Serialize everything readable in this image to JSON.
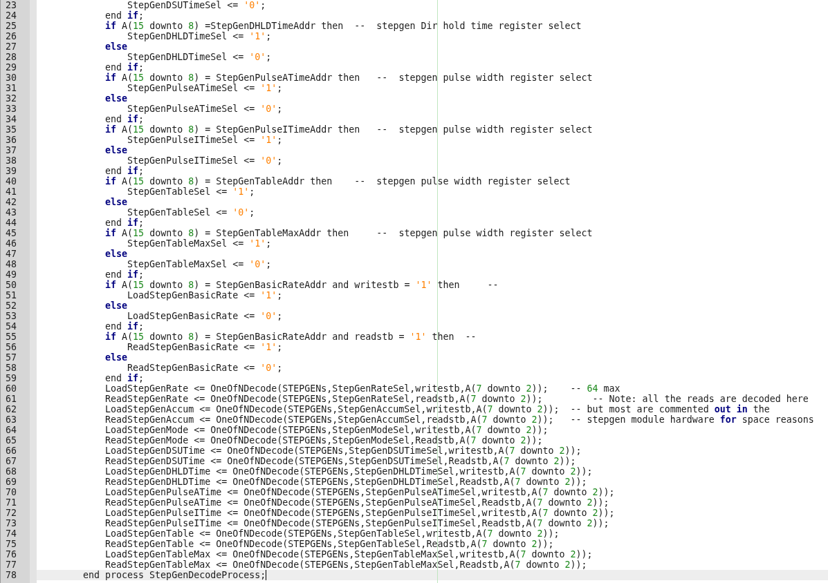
{
  "editor": {
    "lines": [
      {
        "number": "23",
        "current": false,
        "segments": [
          {
            "kind": "plain",
            "text": "                StepGenDSUTimeSel <= "
          },
          {
            "kind": "string",
            "text": "'0'"
          },
          {
            "kind": "plain",
            "text": ";"
          }
        ]
      },
      {
        "number": "24",
        "current": false,
        "segments": [
          {
            "kind": "plain",
            "text": "            end "
          },
          {
            "kind": "keyword",
            "text": "if"
          },
          {
            "kind": "plain",
            "text": ";"
          }
        ]
      },
      {
        "number": "25",
        "current": false,
        "segments": [
          {
            "kind": "keyword",
            "text": "            if"
          },
          {
            "kind": "plain",
            "text": " A("
          },
          {
            "kind": "number",
            "text": "15"
          },
          {
            "kind": "plain",
            "text": " downto "
          },
          {
            "kind": "number",
            "text": "8"
          },
          {
            "kind": "plain",
            "text": ") =StepGenDHLDTimeAddr then  --  stepgen Dir hold time register select"
          }
        ]
      },
      {
        "number": "26",
        "current": false,
        "segments": [
          {
            "kind": "plain",
            "text": "                StepGenDHLDTimeSel <= "
          },
          {
            "kind": "string",
            "text": "'1'"
          },
          {
            "kind": "plain",
            "text": ";"
          }
        ]
      },
      {
        "number": "27",
        "current": false,
        "segments": [
          {
            "kind": "keyword",
            "text": "            else"
          }
        ]
      },
      {
        "number": "28",
        "current": false,
        "segments": [
          {
            "kind": "plain",
            "text": "                StepGenDHLDTimeSel <= "
          },
          {
            "kind": "string",
            "text": "'0'"
          },
          {
            "kind": "plain",
            "text": ";"
          }
        ]
      },
      {
        "number": "29",
        "current": false,
        "segments": [
          {
            "kind": "plain",
            "text": "            end "
          },
          {
            "kind": "keyword",
            "text": "if"
          },
          {
            "kind": "plain",
            "text": ";"
          }
        ]
      },
      {
        "number": "30",
        "current": false,
        "segments": [
          {
            "kind": "keyword",
            "text": "            if"
          },
          {
            "kind": "plain",
            "text": " A("
          },
          {
            "kind": "number",
            "text": "15"
          },
          {
            "kind": "plain",
            "text": " downto "
          },
          {
            "kind": "number",
            "text": "8"
          },
          {
            "kind": "plain",
            "text": ") = StepGenPulseATimeAddr then   --  stepgen pulse width register select"
          }
        ]
      },
      {
        "number": "31",
        "current": false,
        "segments": [
          {
            "kind": "plain",
            "text": "                StepGenPulseATimeSel <= "
          },
          {
            "kind": "string",
            "text": "'1'"
          },
          {
            "kind": "plain",
            "text": ";"
          }
        ]
      },
      {
        "number": "32",
        "current": false,
        "segments": [
          {
            "kind": "keyword",
            "text": "            else"
          }
        ]
      },
      {
        "number": "33",
        "current": false,
        "segments": [
          {
            "kind": "plain",
            "text": "                StepGenPulseATimeSel <= "
          },
          {
            "kind": "string",
            "text": "'0'"
          },
          {
            "kind": "plain",
            "text": ";"
          }
        ]
      },
      {
        "number": "34",
        "current": false,
        "segments": [
          {
            "kind": "plain",
            "text": "            end "
          },
          {
            "kind": "keyword",
            "text": "if"
          },
          {
            "kind": "plain",
            "text": ";"
          }
        ]
      },
      {
        "number": "35",
        "current": false,
        "segments": [
          {
            "kind": "keyword",
            "text": "            if"
          },
          {
            "kind": "plain",
            "text": " A("
          },
          {
            "kind": "number",
            "text": "15"
          },
          {
            "kind": "plain",
            "text": " downto "
          },
          {
            "kind": "number",
            "text": "8"
          },
          {
            "kind": "plain",
            "text": ") = StepGenPulseITimeAddr then   --  stepgen pulse width register select"
          }
        ]
      },
      {
        "number": "36",
        "current": false,
        "segments": [
          {
            "kind": "plain",
            "text": "                StepGenPulseITimeSel <= "
          },
          {
            "kind": "string",
            "text": "'1'"
          },
          {
            "kind": "plain",
            "text": ";"
          }
        ]
      },
      {
        "number": "37",
        "current": false,
        "segments": [
          {
            "kind": "keyword",
            "text": "            else"
          }
        ]
      },
      {
        "number": "38",
        "current": false,
        "segments": [
          {
            "kind": "plain",
            "text": "                StepGenPulseITimeSel <= "
          },
          {
            "kind": "string",
            "text": "'0'"
          },
          {
            "kind": "plain",
            "text": ";"
          }
        ]
      },
      {
        "number": "39",
        "current": false,
        "segments": [
          {
            "kind": "plain",
            "text": "            end "
          },
          {
            "kind": "keyword",
            "text": "if"
          },
          {
            "kind": "plain",
            "text": ";"
          }
        ]
      },
      {
        "number": "40",
        "current": false,
        "segments": [
          {
            "kind": "keyword",
            "text": "            if"
          },
          {
            "kind": "plain",
            "text": " A("
          },
          {
            "kind": "number",
            "text": "15"
          },
          {
            "kind": "plain",
            "text": " downto "
          },
          {
            "kind": "number",
            "text": "8"
          },
          {
            "kind": "plain",
            "text": ") = StepGenTableAddr then    --  stepgen pulse width register select"
          }
        ]
      },
      {
        "number": "41",
        "current": false,
        "segments": [
          {
            "kind": "plain",
            "text": "                StepGenTableSel <= "
          },
          {
            "kind": "string",
            "text": "'1'"
          },
          {
            "kind": "plain",
            "text": ";"
          }
        ]
      },
      {
        "number": "42",
        "current": false,
        "segments": [
          {
            "kind": "keyword",
            "text": "            else"
          }
        ]
      },
      {
        "number": "43",
        "current": false,
        "segments": [
          {
            "kind": "plain",
            "text": "                StepGenTableSel <= "
          },
          {
            "kind": "string",
            "text": "'0'"
          },
          {
            "kind": "plain",
            "text": ";"
          }
        ]
      },
      {
        "number": "44",
        "current": false,
        "segments": [
          {
            "kind": "plain",
            "text": "            end "
          },
          {
            "kind": "keyword",
            "text": "if"
          },
          {
            "kind": "plain",
            "text": ";"
          }
        ]
      },
      {
        "number": "45",
        "current": false,
        "segments": [
          {
            "kind": "keyword",
            "text": "            if"
          },
          {
            "kind": "plain",
            "text": " A("
          },
          {
            "kind": "number",
            "text": "15"
          },
          {
            "kind": "plain",
            "text": " downto "
          },
          {
            "kind": "number",
            "text": "8"
          },
          {
            "kind": "plain",
            "text": ") = StepGenTableMaxAddr then     --  stepgen pulse width register select"
          }
        ]
      },
      {
        "number": "46",
        "current": false,
        "segments": [
          {
            "kind": "plain",
            "text": "                StepGenTableMaxSel <= "
          },
          {
            "kind": "string",
            "text": "'1'"
          },
          {
            "kind": "plain",
            "text": ";"
          }
        ]
      },
      {
        "number": "47",
        "current": false,
        "segments": [
          {
            "kind": "keyword",
            "text": "            else"
          }
        ]
      },
      {
        "number": "48",
        "current": false,
        "segments": [
          {
            "kind": "plain",
            "text": "                StepGenTableMaxSel <= "
          },
          {
            "kind": "string",
            "text": "'0'"
          },
          {
            "kind": "plain",
            "text": ";"
          }
        ]
      },
      {
        "number": "49",
        "current": false,
        "segments": [
          {
            "kind": "plain",
            "text": "            end "
          },
          {
            "kind": "keyword",
            "text": "if"
          },
          {
            "kind": "plain",
            "text": ";"
          }
        ]
      },
      {
        "number": "50",
        "current": false,
        "segments": [
          {
            "kind": "keyword",
            "text": "            if"
          },
          {
            "kind": "plain",
            "text": " A("
          },
          {
            "kind": "number",
            "text": "15"
          },
          {
            "kind": "plain",
            "text": " downto "
          },
          {
            "kind": "number",
            "text": "8"
          },
          {
            "kind": "plain",
            "text": ") = StepGenBasicRateAddr and writestb = "
          },
          {
            "kind": "string",
            "text": "'1'"
          },
          {
            "kind": "plain",
            "text": " then     --"
          }
        ]
      },
      {
        "number": "51",
        "current": false,
        "segments": [
          {
            "kind": "plain",
            "text": "                LoadStepGenBasicRate <= "
          },
          {
            "kind": "string",
            "text": "'1'"
          },
          {
            "kind": "plain",
            "text": ";"
          }
        ]
      },
      {
        "number": "52",
        "current": false,
        "segments": [
          {
            "kind": "keyword",
            "text": "            else"
          }
        ]
      },
      {
        "number": "53",
        "current": false,
        "segments": [
          {
            "kind": "plain",
            "text": "                LoadStepGenBasicRate <= "
          },
          {
            "kind": "string",
            "text": "'0'"
          },
          {
            "kind": "plain",
            "text": ";"
          }
        ]
      },
      {
        "number": "54",
        "current": false,
        "segments": [
          {
            "kind": "plain",
            "text": "            end "
          },
          {
            "kind": "keyword",
            "text": "if"
          },
          {
            "kind": "plain",
            "text": ";"
          }
        ]
      },
      {
        "number": "55",
        "current": false,
        "segments": [
          {
            "kind": "keyword",
            "text": "            if"
          },
          {
            "kind": "plain",
            "text": " A("
          },
          {
            "kind": "number",
            "text": "15"
          },
          {
            "kind": "plain",
            "text": " downto "
          },
          {
            "kind": "number",
            "text": "8"
          },
          {
            "kind": "plain",
            "text": ") = StepGenBasicRateAddr and readstb = "
          },
          {
            "kind": "string",
            "text": "'1'"
          },
          {
            "kind": "plain",
            "text": " then  --"
          }
        ]
      },
      {
        "number": "56",
        "current": false,
        "segments": [
          {
            "kind": "plain",
            "text": "                ReadStepGenBasicRate <= "
          },
          {
            "kind": "string",
            "text": "'1'"
          },
          {
            "kind": "plain",
            "text": ";"
          }
        ]
      },
      {
        "number": "57",
        "current": false,
        "segments": [
          {
            "kind": "keyword",
            "text": "            else"
          }
        ]
      },
      {
        "number": "58",
        "current": false,
        "segments": [
          {
            "kind": "plain",
            "text": "                ReadStepGenBasicRate <= "
          },
          {
            "kind": "string",
            "text": "'0'"
          },
          {
            "kind": "plain",
            "text": ";"
          }
        ]
      },
      {
        "number": "59",
        "current": false,
        "segments": [
          {
            "kind": "plain",
            "text": "            end "
          },
          {
            "kind": "keyword",
            "text": "if"
          },
          {
            "kind": "plain",
            "text": ";"
          }
        ]
      },
      {
        "number": "60",
        "current": false,
        "segments": [
          {
            "kind": "plain",
            "text": "            LoadStepGenRate <= OneOfNDecode(STEPGENs,StepGenRateSel,writestb,A("
          },
          {
            "kind": "number",
            "text": "7"
          },
          {
            "kind": "plain",
            "text": " downto "
          },
          {
            "kind": "number",
            "text": "2"
          },
          {
            "kind": "plain",
            "text": "));    -- "
          },
          {
            "kind": "number",
            "text": "64"
          },
          {
            "kind": "plain",
            "text": " max"
          }
        ]
      },
      {
        "number": "61",
        "current": false,
        "segments": [
          {
            "kind": "plain",
            "text": "            ReadStepGenRate <= OneOfNDecode(STEPGENs,StepGenRateSel,readstb,A("
          },
          {
            "kind": "number",
            "text": "7"
          },
          {
            "kind": "plain",
            "text": " downto "
          },
          {
            "kind": "number",
            "text": "2"
          },
          {
            "kind": "plain",
            "text": "));         -- Note: all the reads are decoded here"
          }
        ]
      },
      {
        "number": "62",
        "current": false,
        "segments": [
          {
            "kind": "plain",
            "text": "            LoadStepGenAccum <= OneOfNDecode(STEPGENs,StepGenAccumSel,writestb,A("
          },
          {
            "kind": "number",
            "text": "7"
          },
          {
            "kind": "plain",
            "text": " downto "
          },
          {
            "kind": "number",
            "text": "2"
          },
          {
            "kind": "plain",
            "text": "));  -- but most are commented "
          },
          {
            "kind": "keyword",
            "text": "out in"
          },
          {
            "kind": "plain",
            "text": " the"
          }
        ]
      },
      {
        "number": "63",
        "current": false,
        "segments": [
          {
            "kind": "plain",
            "text": "            ReadStepGenAccum <= OneOfNDecode(STEPGENs,StepGenAccumSel,readstb,A("
          },
          {
            "kind": "number",
            "text": "7"
          },
          {
            "kind": "plain",
            "text": " downto "
          },
          {
            "kind": "number",
            "text": "2"
          },
          {
            "kind": "plain",
            "text": "));   -- stepgen module hardware "
          },
          {
            "kind": "keyword",
            "text": "for"
          },
          {
            "kind": "plain",
            "text": " space reasons"
          }
        ]
      },
      {
        "number": "64",
        "current": false,
        "segments": [
          {
            "kind": "plain",
            "text": "            LoadStepGenMode <= OneOfNDecode(STEPGENs,StepGenModeSel,writestb,A("
          },
          {
            "kind": "number",
            "text": "7"
          },
          {
            "kind": "plain",
            "text": " downto "
          },
          {
            "kind": "number",
            "text": "2"
          },
          {
            "kind": "plain",
            "text": "));"
          }
        ]
      },
      {
        "number": "65",
        "current": false,
        "segments": [
          {
            "kind": "plain",
            "text": "            ReadStepGenMode <= OneOfNDecode(STEPGENs,StepGenModeSel,Readstb,A("
          },
          {
            "kind": "number",
            "text": "7"
          },
          {
            "kind": "plain",
            "text": " downto "
          },
          {
            "kind": "number",
            "text": "2"
          },
          {
            "kind": "plain",
            "text": "));"
          }
        ]
      },
      {
        "number": "66",
        "current": false,
        "segments": [
          {
            "kind": "plain",
            "text": "            LoadStepGenDSUTime <= OneOfNDecode(STEPGENs,StepGenDSUTimeSel,writestb,A("
          },
          {
            "kind": "number",
            "text": "7"
          },
          {
            "kind": "plain",
            "text": " downto "
          },
          {
            "kind": "number",
            "text": "2"
          },
          {
            "kind": "plain",
            "text": "));"
          }
        ]
      },
      {
        "number": "67",
        "current": false,
        "segments": [
          {
            "kind": "plain",
            "text": "            ReadStepGenDSUTime <= OneOfNDecode(STEPGENs,StepGenDSUTimeSel,Readstb,A("
          },
          {
            "kind": "number",
            "text": "7"
          },
          {
            "kind": "plain",
            "text": " downto "
          },
          {
            "kind": "number",
            "text": "2"
          },
          {
            "kind": "plain",
            "text": "));"
          }
        ]
      },
      {
        "number": "68",
        "current": false,
        "segments": [
          {
            "kind": "plain",
            "text": "            LoadStepGenDHLDTime <= OneOfNDecode(STEPGENs,StepGenDHLDTimeSel,writestb,A("
          },
          {
            "kind": "number",
            "text": "7"
          },
          {
            "kind": "plain",
            "text": " downto "
          },
          {
            "kind": "number",
            "text": "2"
          },
          {
            "kind": "plain",
            "text": "));"
          }
        ]
      },
      {
        "number": "69",
        "current": false,
        "segments": [
          {
            "kind": "plain",
            "text": "            ReadStepGenDHLDTime <= OneOfNDecode(STEPGENs,StepGenDHLDTimeSel,Readstb,A("
          },
          {
            "kind": "number",
            "text": "7"
          },
          {
            "kind": "plain",
            "text": " downto "
          },
          {
            "kind": "number",
            "text": "2"
          },
          {
            "kind": "plain",
            "text": "));"
          }
        ]
      },
      {
        "number": "70",
        "current": false,
        "segments": [
          {
            "kind": "plain",
            "text": "            LoadStepGenPulseATime <= OneOfNDecode(STEPGENs,StepGenPulseATimeSel,writestb,A("
          },
          {
            "kind": "number",
            "text": "7"
          },
          {
            "kind": "plain",
            "text": " downto "
          },
          {
            "kind": "number",
            "text": "2"
          },
          {
            "kind": "plain",
            "text": "));"
          }
        ]
      },
      {
        "number": "71",
        "current": false,
        "segments": [
          {
            "kind": "plain",
            "text": "            ReadStepGenPulseATime <= OneOfNDecode(STEPGENs,StepGenPulseATimeSel,Readstb,A("
          },
          {
            "kind": "number",
            "text": "7"
          },
          {
            "kind": "plain",
            "text": " downto "
          },
          {
            "kind": "number",
            "text": "2"
          },
          {
            "kind": "plain",
            "text": "));"
          }
        ]
      },
      {
        "number": "72",
        "current": false,
        "segments": [
          {
            "kind": "plain",
            "text": "            LoadStepGenPulseITime <= OneOfNDecode(STEPGENs,StepGenPulseITimeSel,writestb,A("
          },
          {
            "kind": "number",
            "text": "7"
          },
          {
            "kind": "plain",
            "text": " downto "
          },
          {
            "kind": "number",
            "text": "2"
          },
          {
            "kind": "plain",
            "text": "));"
          }
        ]
      },
      {
        "number": "73",
        "current": false,
        "segments": [
          {
            "kind": "plain",
            "text": "            ReadStepGenPulseITime <= OneOfNDecode(STEPGENs,StepGenPulseITimeSel,Readstb,A("
          },
          {
            "kind": "number",
            "text": "7"
          },
          {
            "kind": "plain",
            "text": " downto "
          },
          {
            "kind": "number",
            "text": "2"
          },
          {
            "kind": "plain",
            "text": "));"
          }
        ]
      },
      {
        "number": "74",
        "current": false,
        "segments": [
          {
            "kind": "plain",
            "text": "            LoadStepGenTable <= OneOfNDecode(STEPGENs,StepGenTableSel,writestb,A("
          },
          {
            "kind": "number",
            "text": "7"
          },
          {
            "kind": "plain",
            "text": " downto "
          },
          {
            "kind": "number",
            "text": "2"
          },
          {
            "kind": "plain",
            "text": "));"
          }
        ]
      },
      {
        "number": "75",
        "current": false,
        "segments": [
          {
            "kind": "plain",
            "text": "            ReadStepGenTable <= OneOfNDecode(STEPGENs,StepGenTableSel,Readstb,A("
          },
          {
            "kind": "number",
            "text": "7"
          },
          {
            "kind": "plain",
            "text": " downto "
          },
          {
            "kind": "number",
            "text": "2"
          },
          {
            "kind": "plain",
            "text": "));"
          }
        ]
      },
      {
        "number": "76",
        "current": false,
        "segments": [
          {
            "kind": "plain",
            "text": "            LoadStepGenTableMax <= OneOfNDecode(STEPGENs,StepGenTableMaxSel,writestb,A("
          },
          {
            "kind": "number",
            "text": "7"
          },
          {
            "kind": "plain",
            "text": " downto "
          },
          {
            "kind": "number",
            "text": "2"
          },
          {
            "kind": "plain",
            "text": "));"
          }
        ]
      },
      {
        "number": "77",
        "current": false,
        "segments": [
          {
            "kind": "plain",
            "text": "            ReadStepGenTableMax <= OneOfNDecode(STEPGENs,StepGenTableMaxSel,Readstb,A("
          },
          {
            "kind": "number",
            "text": "7"
          },
          {
            "kind": "plain",
            "text": " downto "
          },
          {
            "kind": "number",
            "text": "2"
          },
          {
            "kind": "plain",
            "text": "));"
          }
        ]
      },
      {
        "number": "78",
        "current": true,
        "segments": [
          {
            "kind": "plain",
            "text": "        end process StepGenDecodeProcess;"
          }
        ]
      }
    ]
  }
}
